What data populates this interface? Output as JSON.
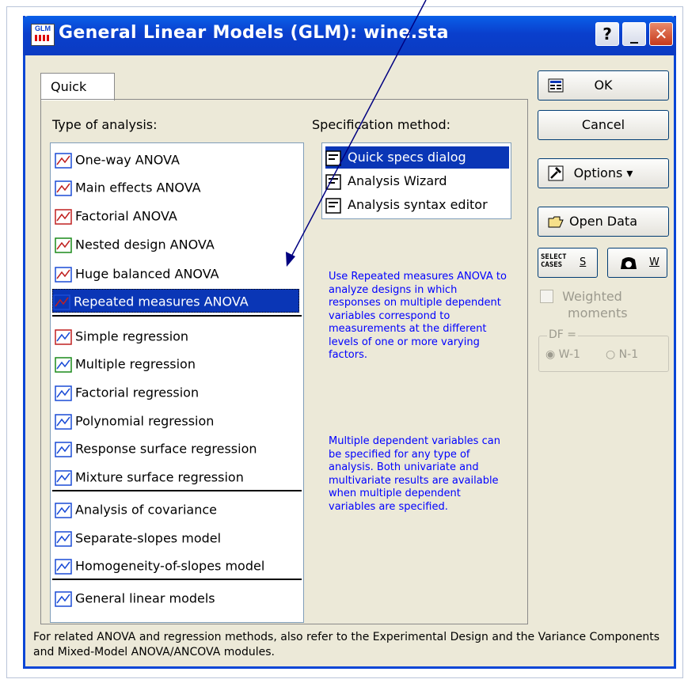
{
  "window": {
    "icon_label": "GLM",
    "title": "General Linear Models (GLM): wine.sta",
    "help": "?",
    "minimize": "_",
    "close": "✕"
  },
  "tab": {
    "label": "Quick"
  },
  "analysis": {
    "heading": "Type of analysis:",
    "groups": [
      [
        "One-way ANOVA",
        "Main effects ANOVA",
        "Factorial ANOVA",
        "Nested design ANOVA",
        "Huge balanced ANOVA",
        "Repeated measures ANOVA"
      ],
      [
        "Simple regression",
        "Multiple regression",
        "Factorial regression",
        "Polynomial regression",
        "Response surface regression",
        "Mixture surface regression"
      ],
      [
        "Analysis of covariance",
        "Separate-slopes model",
        "Homogeneity-of-slopes model"
      ],
      [
        "General linear models"
      ]
    ],
    "selected": "Repeated measures ANOVA"
  },
  "spec": {
    "heading": "Specification method:",
    "items": [
      "Quick specs dialog",
      "Analysis Wizard",
      "Analysis syntax editor"
    ],
    "selected": "Quick specs dialog"
  },
  "description": {
    "p1": "Use Repeated measures ANOVA to analyze designs in which responses on multiple dependent variables correspond to measurements at the different levels of one or more varying factors.",
    "p2": "Multiple dependent variables can be specified for any type of analysis.  Both univariate and multivariate results are available when multiple dependent variables are specified."
  },
  "buttons": {
    "ok": "OK",
    "cancel": "Cancel",
    "options": "Options",
    "open_data": "Open Data",
    "select_cases_line1": "SELECT",
    "select_cases_line2": "CASES",
    "select_cases_key": "S",
    "weights_key": "W"
  },
  "weighted": {
    "line1": "Weighted",
    "line2": "moments"
  },
  "df": {
    "label": "DF =",
    "opt1": "W-1",
    "opt2": "N-1"
  },
  "status": "For related ANOVA and regression methods, also refer to the Experimental Design and the Variance Components and Mixed-Model ANOVA/ANCOVA modules.",
  "colors": {
    "title_bar": "#0a46d6",
    "selection": "#0a36b6",
    "description_text": "#0000ff",
    "dialog_bg": "#ece9d8"
  }
}
